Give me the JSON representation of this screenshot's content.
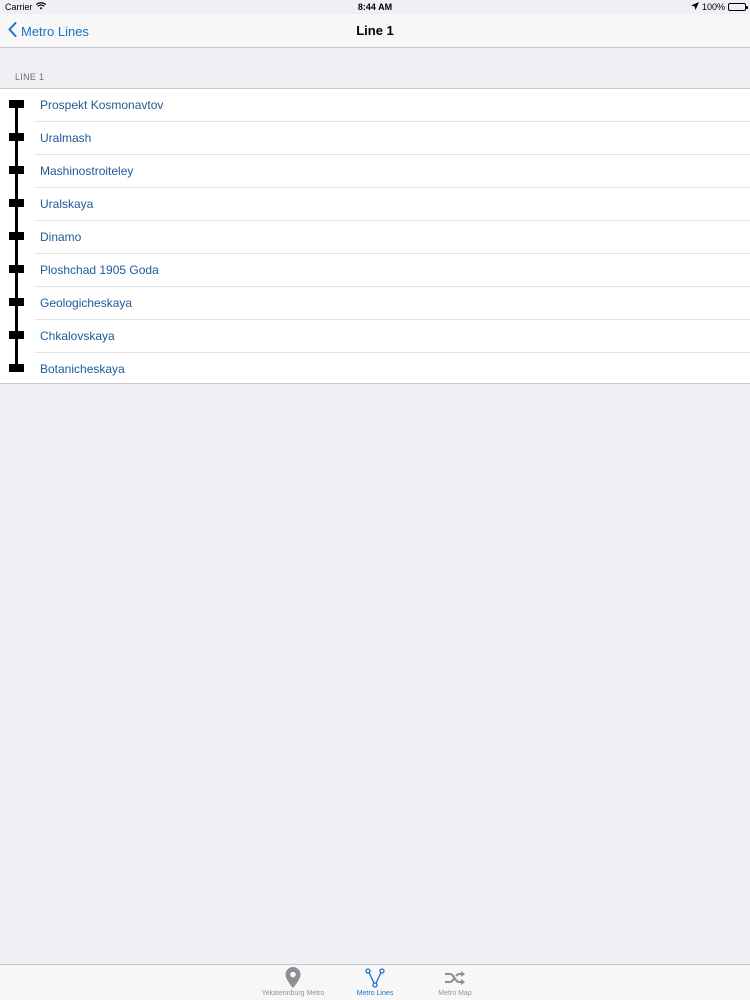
{
  "status_bar": {
    "carrier": "Carrier",
    "time": "8:44 AM",
    "battery": "100%"
  },
  "nav": {
    "back_label": "Metro Lines",
    "title": "Line 1"
  },
  "section": {
    "header": "LINE 1"
  },
  "stations": [
    "Prospekt Kosmonavtov",
    "Uralmash",
    "Mashinostroiteley",
    "Uralskaya",
    "Dinamo",
    "Ploshchad 1905 Goda",
    "Geologicheskaya",
    "Chkalovskaya",
    "Botanicheskaya"
  ],
  "tabs": [
    {
      "label": "Yekaterinburg Metro",
      "icon": "location-pin-icon",
      "active": false
    },
    {
      "label": "Metro Lines",
      "icon": "branch-lines-icon",
      "active": true
    },
    {
      "label": "Metro Map",
      "icon": "shuffle-icon",
      "active": false
    }
  ],
  "colors": {
    "accent": "#1a73c9",
    "station_text": "#1e5a96",
    "background": "#efeff4"
  }
}
